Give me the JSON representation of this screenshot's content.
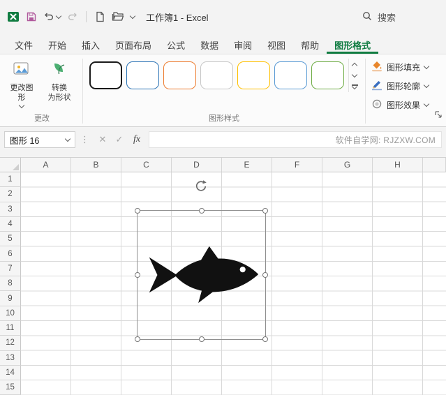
{
  "titlebar": {
    "title": "工作簿1 - Excel",
    "search_label": "搜索"
  },
  "tabs": [
    "文件",
    "开始",
    "插入",
    "页面布局",
    "公式",
    "数据",
    "审阅",
    "视图",
    "帮助",
    "图形格式"
  ],
  "active_tab": "图形格式",
  "ribbon": {
    "change_group": {
      "label": "更改",
      "change_shape_label": "更改图\n形",
      "convert_label": "转换\n为形状"
    },
    "styles_group": {
      "label": "图形样式",
      "items": [
        {
          "name": "style-black-outline",
          "style": "border:2.5px solid #1a1a1a"
        },
        {
          "name": "style-blue-outline",
          "style": "border:1.5px solid #2e75b6"
        },
        {
          "name": "style-orange-outline",
          "style": "border:1.5px solid #ed7d31"
        },
        {
          "name": "style-gray-outline",
          "style": "border:1.5px solid #c8c8c8"
        },
        {
          "name": "style-yellow-outline",
          "style": "border:1.5px solid #ffc000"
        },
        {
          "name": "style-lightblue-outline",
          "style": "border:1.5px solid #5b9bd5"
        },
        {
          "name": "style-green-outline",
          "style": "border:1.5px solid #70ad47"
        }
      ]
    },
    "format_group": {
      "fill_label": "图形填充",
      "outline_label": "图形轮廓",
      "effects_label": "图形效果"
    }
  },
  "formula_bar": {
    "name_box": "图形 16",
    "dots": "⋮",
    "cancel_icon": "✕",
    "enter_icon": "✓",
    "fx_label": "fx",
    "watermark": "软件自学网: RJZXW.COM"
  },
  "sheet": {
    "columns": [
      "A",
      "B",
      "C",
      "D",
      "E",
      "F",
      "G",
      "H"
    ],
    "rows": [
      "1",
      "2",
      "3",
      "4",
      "5",
      "6",
      "7",
      "8",
      "9",
      "10",
      "11",
      "12",
      "13",
      "14",
      "15"
    ],
    "selected_shape": "fish clip art"
  },
  "colors": {
    "accent_green": "#107c41",
    "fill_orange": "#e8862c",
    "outline_blue": "#3a6fc0",
    "shape_black": "#111111"
  }
}
